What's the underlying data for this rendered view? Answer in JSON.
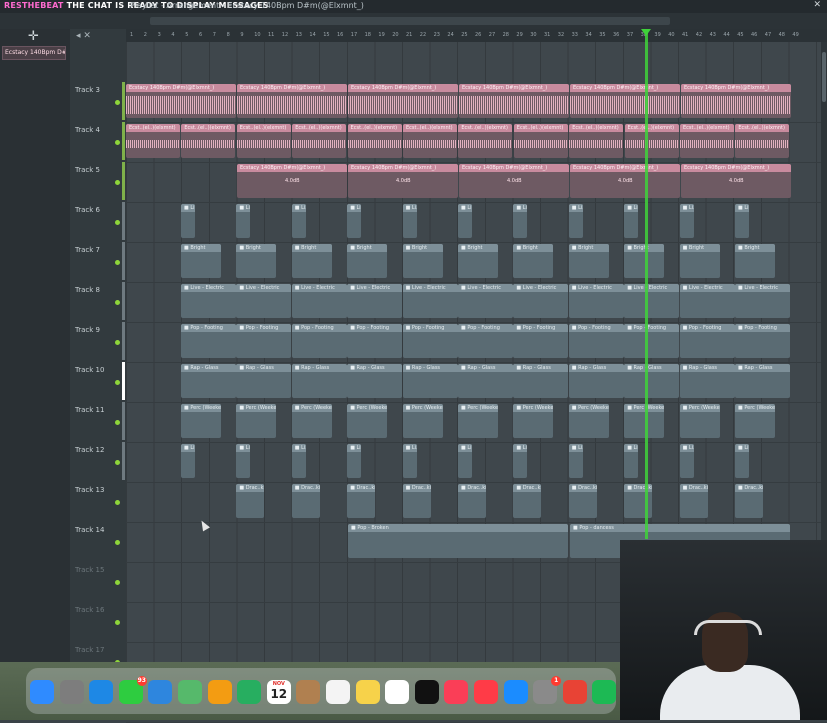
{
  "window": {
    "overlay_user": "RESTHEBEAT",
    "overlay_message": "THE CHAT IS READY TO DISPLAY MESSAGES",
    "title": "Playlist - Arrangement › Ecstacy 140Bpm D#m(@Elxmnt_)"
  },
  "browser": {
    "pattern_label": "Ecstacy 140Bpm D#..."
  },
  "ruler": {
    "ticks": [
      "1",
      "2",
      "3",
      "4",
      "5",
      "6",
      "7",
      "8",
      "9",
      "10",
      "11",
      "12",
      "13",
      "14",
      "15",
      "16",
      "17",
      "18",
      "19",
      "20",
      "21",
      "22",
      "23",
      "24",
      "25",
      "26",
      "27",
      "28",
      "29",
      "30",
      "31",
      "32",
      "33",
      "34",
      "35",
      "36",
      "37",
      "38",
      "39",
      "40",
      "41",
      "42",
      "43",
      "44",
      "45",
      "46",
      "47",
      "48",
      "49"
    ]
  },
  "tracks": [
    {
      "name": "Track 3"
    },
    {
      "name": "Track 4"
    },
    {
      "name": "Track 5"
    },
    {
      "name": "Track 6"
    },
    {
      "name": "Track 7"
    },
    {
      "name": "Track 8"
    },
    {
      "name": "Track 9"
    },
    {
      "name": "Track 10"
    },
    {
      "name": "Track 11"
    },
    {
      "name": "Track 12"
    },
    {
      "name": "Track 13"
    },
    {
      "name": "Track 14"
    },
    {
      "name": "Track 15"
    },
    {
      "name": "Track 16"
    },
    {
      "name": "Track 17"
    }
  ],
  "clips": {
    "audio_main": "Ecstacy 140Bpm D#m(@Elxmnt_)",
    "audio_short": "Ecst..(el..)(elxmnt)",
    "track5_label": "4.0dB",
    "t6": "■ Li..",
    "t7": "■ Bright",
    "t8": "■ Live - Electric",
    "t9": "■ Pop - Footing",
    "t10": "■ Rap - Glass",
    "t11": "■ Perc (Weekend)",
    "t12": "■ Li..",
    "t13": "■ Drac..kick",
    "t14a": "■ Pop - Broken",
    "t14b": "■ Pop - dancess"
  },
  "dock": {
    "calendar_month": "NOV",
    "calendar_day": "12",
    "messages_badge": "93",
    "settings_badge": "1",
    "apps": [
      "Finder",
      "Launchpad",
      "Safari",
      "Messages",
      "Mail",
      "Maps",
      "Photos",
      "FaceTime",
      "Calendar",
      "Contacts",
      "Reminders",
      "Notes",
      "Freeform",
      "TV",
      "Music",
      "News",
      "App Store",
      "System Settings",
      "Chrome",
      "Spotify"
    ]
  }
}
